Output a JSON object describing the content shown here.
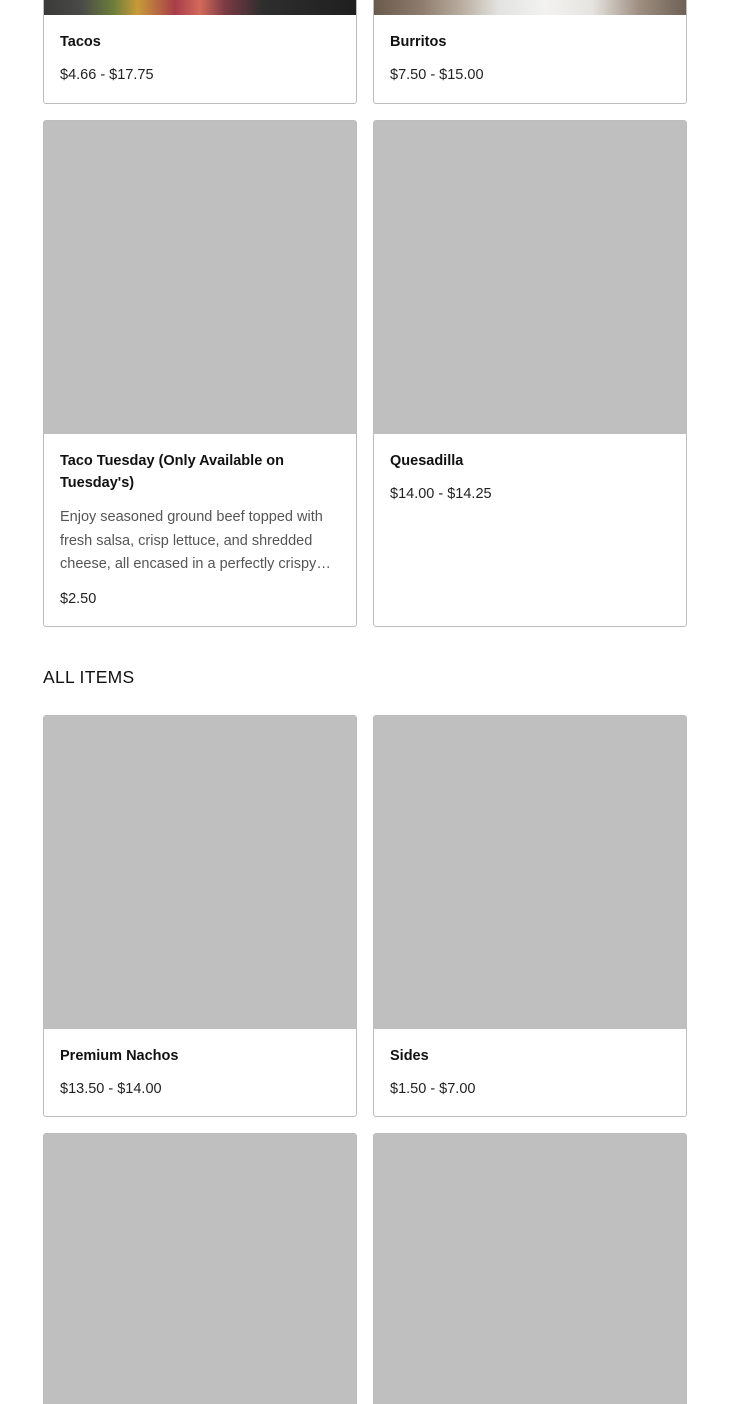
{
  "featured": [
    {
      "title": "Tacos",
      "price": "$4.66 - $17.75"
    },
    {
      "title": "Burritos",
      "price": "$7.50 - $15.00"
    },
    {
      "title": "Taco Tuesday (Only Available on Tuesday's)",
      "description": "Enjoy seasoned ground beef topped with fresh salsa, crisp lettuce, and shredded cheese, all encased in a perfectly crispy shell.",
      "price": "$2.50"
    },
    {
      "title": "Quesadilla",
      "price": "$14.00 - $14.25"
    }
  ],
  "all_items": {
    "heading": "ALL ITEMS",
    "items": [
      {
        "title": "Premium Nachos",
        "price": "$13.50 - $14.00"
      },
      {
        "title": "Sides",
        "price": "$1.50 - $7.00"
      }
    ]
  }
}
